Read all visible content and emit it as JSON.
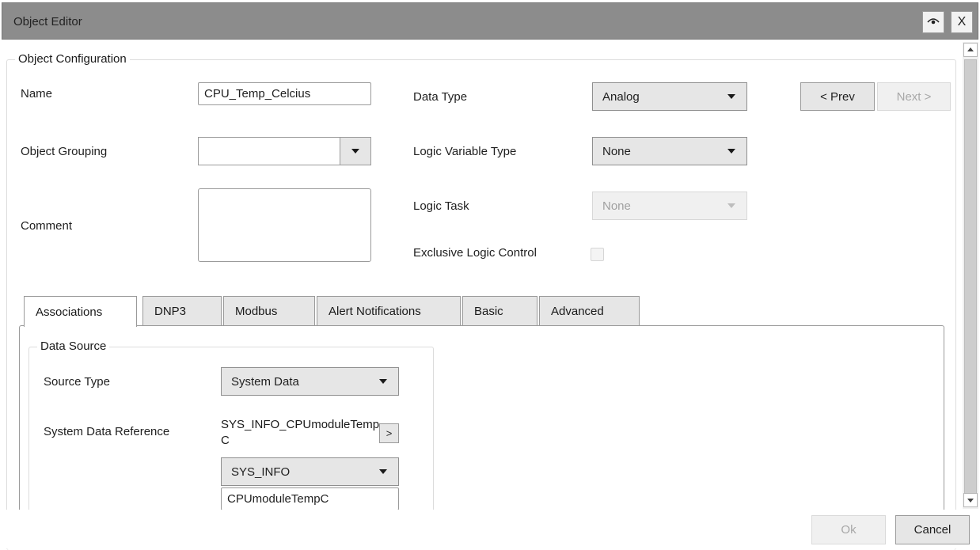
{
  "window": {
    "title": "Object Editor",
    "eye_icon": "eye-icon",
    "close_label": "X"
  },
  "config": {
    "section_title": "Object Configuration",
    "name_label": "Name",
    "name_value": "CPU_Temp_Celcius",
    "grouping_label": "Object Grouping",
    "grouping_value": "",
    "comment_label": "Comment",
    "comment_value": "",
    "data_type_label": "Data Type",
    "data_type_value": "Analog",
    "logic_var_label": "Logic Variable Type",
    "logic_var_value": "None",
    "logic_task_label": "Logic Task",
    "logic_task_value": "None",
    "exclusive_label": "Exclusive Logic Control",
    "exclusive_checked": false,
    "prev_label": "< Prev",
    "next_label": "Next >"
  },
  "tabs": [
    {
      "label": "Associations",
      "active": true
    },
    {
      "label": "DNP3",
      "active": false
    },
    {
      "label": "Modbus",
      "active": false
    },
    {
      "label": "Alert Notifications",
      "active": false
    },
    {
      "label": "Basic",
      "active": false
    },
    {
      "label": "Advanced",
      "active": false
    }
  ],
  "data_source": {
    "title": "Data Source",
    "source_type_label": "Source Type",
    "source_type_value": "System Data",
    "sys_ref_label": "System Data Reference",
    "sys_ref_line1": "SYS_INFO_CPUmoduleTemp",
    "sys_ref_line2": "C",
    "sys_ref_button": ">",
    "category_value": "SYS_INFO",
    "item_value": "CPUmoduleTempC"
  },
  "footer": {
    "ok_label": "Ok",
    "cancel_label": "Cancel"
  }
}
